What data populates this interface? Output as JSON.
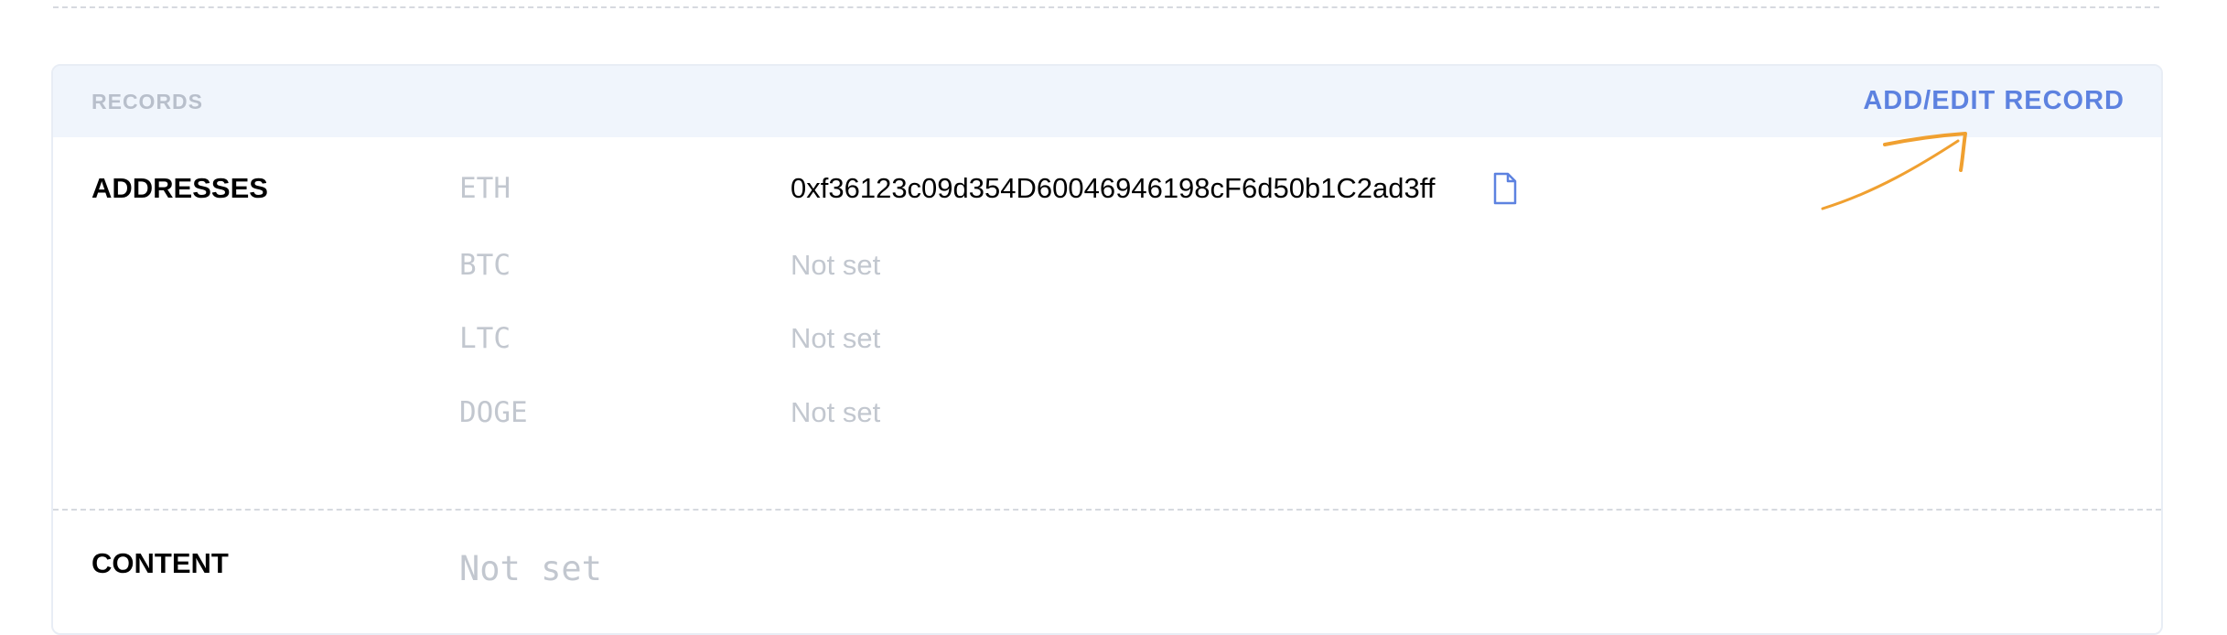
{
  "records": {
    "header_title": "RECORDS",
    "add_edit_label": "ADD/EDIT RECORD",
    "addresses": {
      "label": "ADDRESSES",
      "items": [
        {
          "coin": "ETH",
          "value": "0xf36123c09d354D60046946198cF6d50b1C2ad3ff"
        },
        {
          "coin": "BTC",
          "value": "Not set"
        },
        {
          "coin": "LTC",
          "value": "Not set"
        },
        {
          "coin": "DOGE",
          "value": "Not set"
        }
      ]
    },
    "content": {
      "label": "CONTENT",
      "value": "Not set"
    }
  },
  "icons": {
    "copy": "copy-document-icon",
    "hint_arrow": "arrow-annotation-icon"
  },
  "colors": {
    "accent": "#5d82e0",
    "header_bg": "#f0f5fc",
    "muted": "#c2c7cf",
    "annotation": "#f0a030"
  }
}
